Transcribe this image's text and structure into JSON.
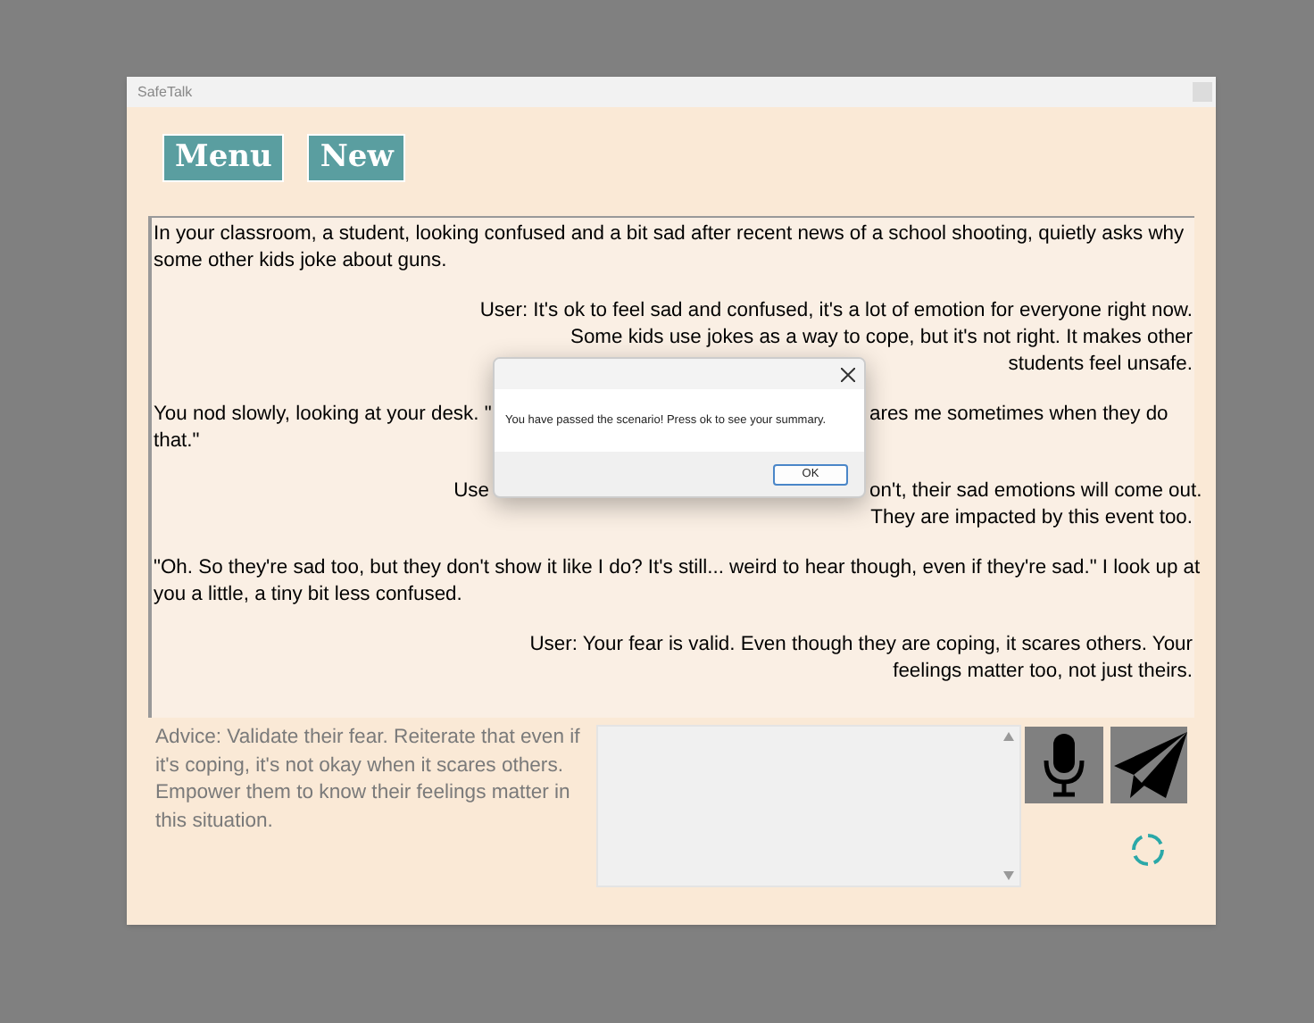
{
  "window": {
    "title": "SafeTalk"
  },
  "buttons": [
    {
      "label": "Menu"
    },
    {
      "label": "New"
    }
  ],
  "messages": [
    {
      "kind": "narration",
      "lines": [
        [
          "In your classroom, a student, looking confused and a bit sad after recent news of a school shooting, quietly asks why"
        ],
        [
          "some other kids joke about guns."
        ]
      ]
    },
    {
      "kind": "user",
      "lines": [
        [
          "User: It's ok to feel sad and confused, it's a lot of emotion for everyone right now."
        ],
        [
          "Some kids use jokes as a way to cope, but it's not right. It makes other"
        ],
        [
          "students feel unsafe."
        ]
      ]
    },
    {
      "kind": "narration",
      "lines": [
        [
          "You nod slowly, looking at your desk. \"",
          "ares me sometimes when they do"
        ],
        [
          "that.\""
        ]
      ]
    },
    {
      "kind": "user",
      "lines": [
        [
          "Use",
          "on't, their sad emotions will come out."
        ],
        [
          "They are impacted by this event too."
        ]
      ]
    },
    {
      "kind": "narration",
      "lines": [
        [
          "\"Oh. So they're sad too, but they don't show it like I do? It's still... weird to hear though, even if they're sad.\" I look up at"
        ],
        [
          "you a little, a tiny bit less confused."
        ]
      ]
    },
    {
      "kind": "user",
      "lines": [
        [
          "User: Your fear is valid. Even though they are coping, it scares others. Your"
        ],
        [
          "feelings matter too, not just theirs."
        ]
      ]
    }
  ],
  "advice": "Advice: Validate their fear. Reiterate that even if it's coping, it's not okay when it scares others. Empower them to know their feelings matter in this situation.",
  "dialog": {
    "message": "You have passed the scenario! Press ok to see your summary.",
    "button": "OK"
  }
}
